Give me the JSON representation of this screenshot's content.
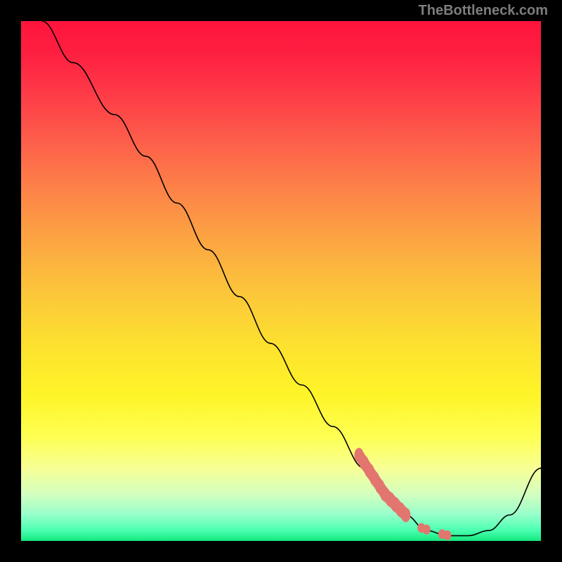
{
  "watermark": "TheBottleneck.com",
  "chart_data": {
    "type": "line",
    "title": "",
    "xlabel": "",
    "ylabel": "",
    "xlim": [
      0,
      100
    ],
    "ylim": [
      0,
      100
    ],
    "grid": false,
    "series": [
      {
        "name": "bottleneck-curve",
        "color": "#000000",
        "x": [
          4,
          10,
          18,
          24,
          30,
          36,
          42,
          48,
          54,
          60,
          66,
          70,
          74,
          78,
          82,
          86,
          90,
          94,
          100
        ],
        "y": [
          100,
          92,
          82,
          74,
          65,
          56,
          47,
          38,
          30,
          22,
          14,
          9,
          5,
          2,
          1,
          1,
          2,
          5,
          14
        ]
      }
    ],
    "highlight": {
      "name": "highlighted-segment",
      "color": "#e2766f",
      "points": [
        {
          "x": 65,
          "y": 16.5
        },
        {
          "x": 66,
          "y": 15
        },
        {
          "x": 67,
          "y": 13.5
        },
        {
          "x": 68,
          "y": 12
        },
        {
          "x": 69,
          "y": 10.5
        },
        {
          "x": 70,
          "y": 9
        },
        {
          "x": 71,
          "y": 8
        },
        {
          "x": 72,
          "y": 7
        },
        {
          "x": 73,
          "y": 6
        },
        {
          "x": 74,
          "y": 5
        }
      ],
      "isolated": [
        {
          "x": 77,
          "y": 2.5
        },
        {
          "x": 78,
          "y": 2.2
        },
        {
          "x": 81,
          "y": 1.3
        },
        {
          "x": 82,
          "y": 1.1
        }
      ]
    }
  }
}
